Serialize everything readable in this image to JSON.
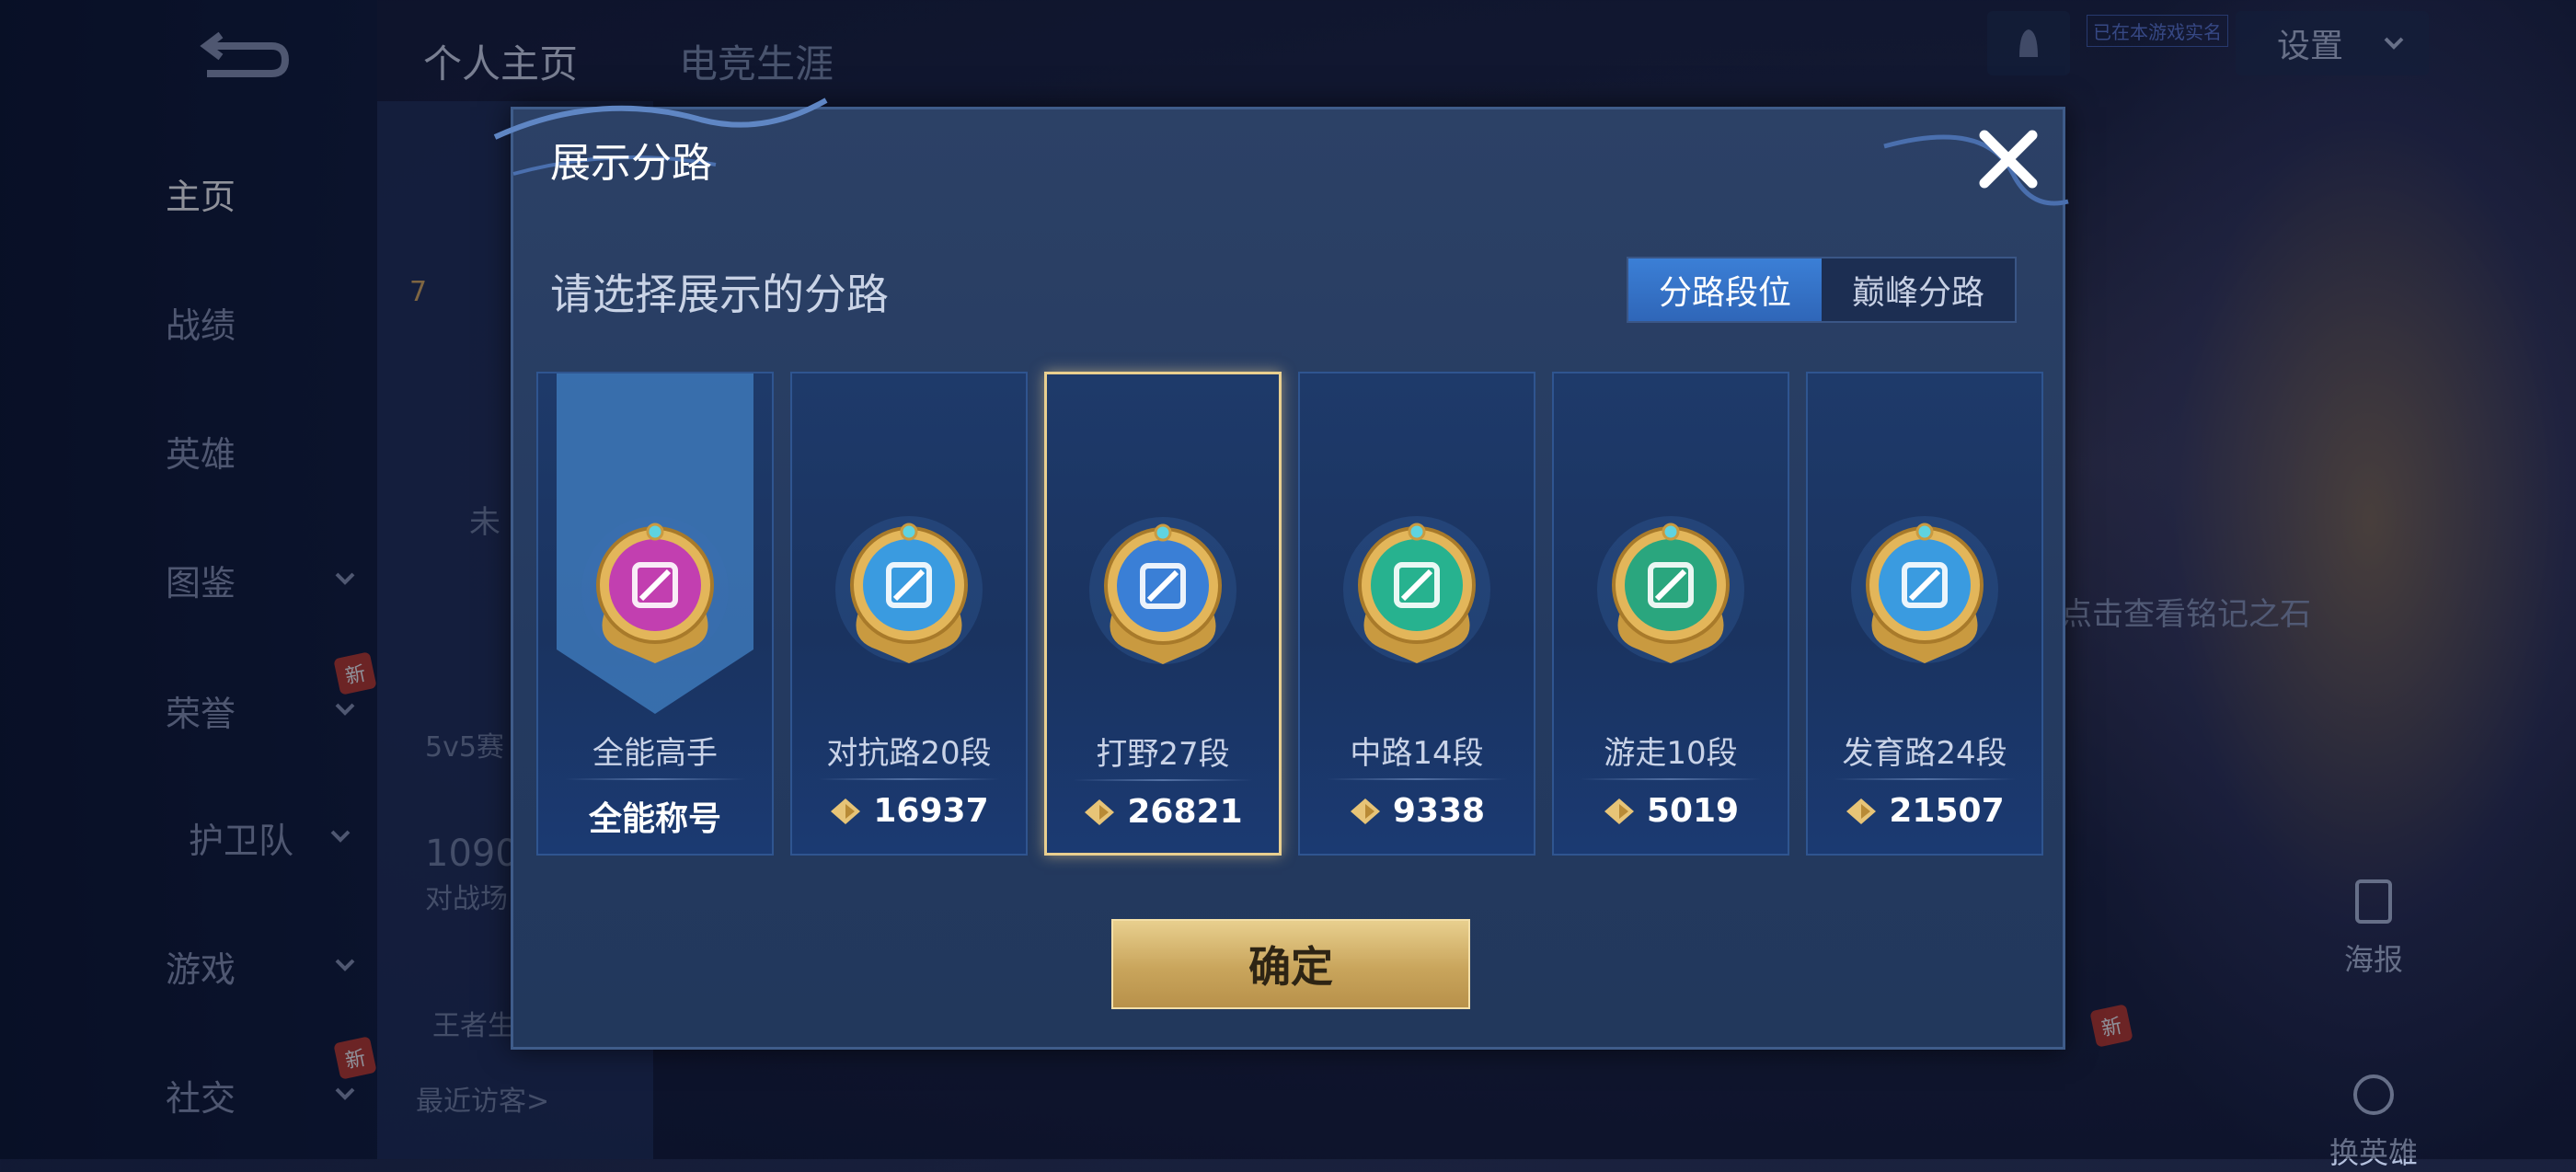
{
  "background": {
    "sidebar": {
      "items": [
        {
          "label": "主页",
          "active": true
        },
        {
          "label": "战绩"
        },
        {
          "label": "英雄"
        },
        {
          "label": "图鉴"
        },
        {
          "label": "荣誉",
          "badge": "新"
        },
        {
          "label": "护卫队"
        },
        {
          "label": "游戏"
        },
        {
          "label": "社交",
          "badge": "新"
        }
      ]
    },
    "tabs": [
      "个人主页",
      "电竞生涯"
    ],
    "settings_label": "设置",
    "realname_tag": "已在本游戏实名",
    "behind_texts": {
      "level": "7",
      "status": "未",
      "mode": "5v5赛",
      "count": "1090",
      "battle": "对战场",
      "king": "王者生",
      "visitors": "最近访客>",
      "rune_hint": "点击查看铭记之石",
      "poster": "海报",
      "swap_hero": "换英雄",
      "new_badge": "新"
    }
  },
  "modal": {
    "title": "展示分路",
    "subtitle": "请选择展示的分路",
    "segmented": {
      "options": [
        "分路段位",
        "巅峰分路"
      ],
      "selected": 0
    },
    "cards": [
      {
        "name": "全能高手",
        "score": "全能称号",
        "icon": "all-round-icon",
        "color": "#c23fb0",
        "has_gem": false
      },
      {
        "name": "对抗路20段",
        "score": "16937",
        "icon": "clash-lane-icon",
        "color": "#3a9be0",
        "has_gem": true
      },
      {
        "name": "打野27段",
        "score": "26821",
        "icon": "jungle-icon",
        "color": "#3a7fd6",
        "has_gem": true
      },
      {
        "name": "中路14段",
        "score": "9338",
        "icon": "mid-lane-icon",
        "color": "#27b28f",
        "has_gem": true
      },
      {
        "name": "游走10段",
        "score": "5019",
        "icon": "roam-icon",
        "color": "#2aa67e",
        "has_gem": true
      },
      {
        "name": "发育路24段",
        "score": "21507",
        "icon": "farm-lane-icon",
        "color": "#3a9be0",
        "has_gem": true
      }
    ],
    "selected_card": 2,
    "confirm_label": "确定"
  }
}
